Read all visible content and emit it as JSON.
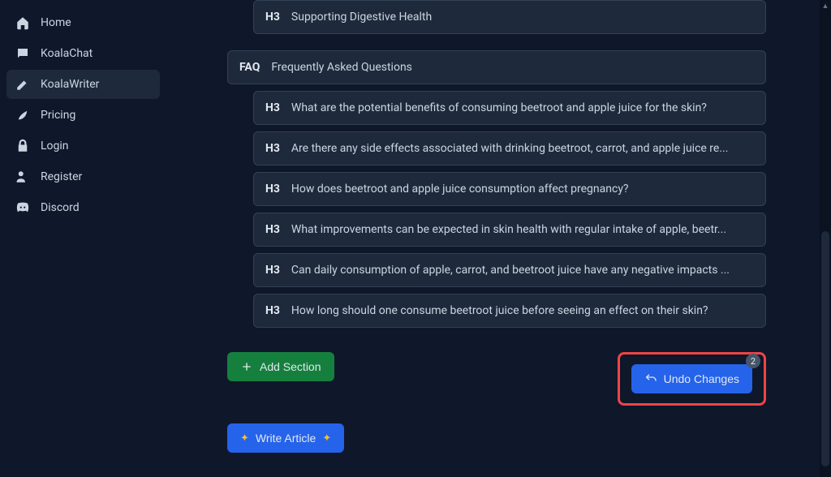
{
  "sidebar": {
    "items": [
      {
        "label": "Home"
      },
      {
        "label": "KoalaChat"
      },
      {
        "label": "KoalaWriter"
      },
      {
        "label": "Pricing"
      },
      {
        "label": "Login"
      },
      {
        "label": "Register"
      },
      {
        "label": "Discord"
      }
    ]
  },
  "outline": [
    {
      "tag": "H3",
      "text": "Supporting Digestive Health",
      "indent": 1
    },
    {
      "tag": "FAQ",
      "text": "Frequently Asked Questions",
      "indent": 0,
      "faq": true
    },
    {
      "tag": "H3",
      "text": "What are the potential benefits of consuming beetroot and apple juice for the skin?",
      "indent": 1
    },
    {
      "tag": "H3",
      "text": "Are there any side effects associated with drinking beetroot, carrot, and apple juice re...",
      "indent": 1
    },
    {
      "tag": "H3",
      "text": "How does beetroot and apple juice consumption affect pregnancy?",
      "indent": 1
    },
    {
      "tag": "H3",
      "text": "What improvements can be expected in skin health with regular intake of apple, beetr...",
      "indent": 1
    },
    {
      "tag": "H3",
      "text": "Can daily consumption of apple, carrot, and beetroot juice have any negative impacts ...",
      "indent": 1
    },
    {
      "tag": "H3",
      "text": "How long should one consume beetroot juice before seeing an effect on their skin?",
      "indent": 1
    }
  ],
  "buttons": {
    "add_section": "Add Section",
    "undo_changes": "Undo Changes",
    "write_article": "Write Article",
    "undo_badge": "2"
  }
}
